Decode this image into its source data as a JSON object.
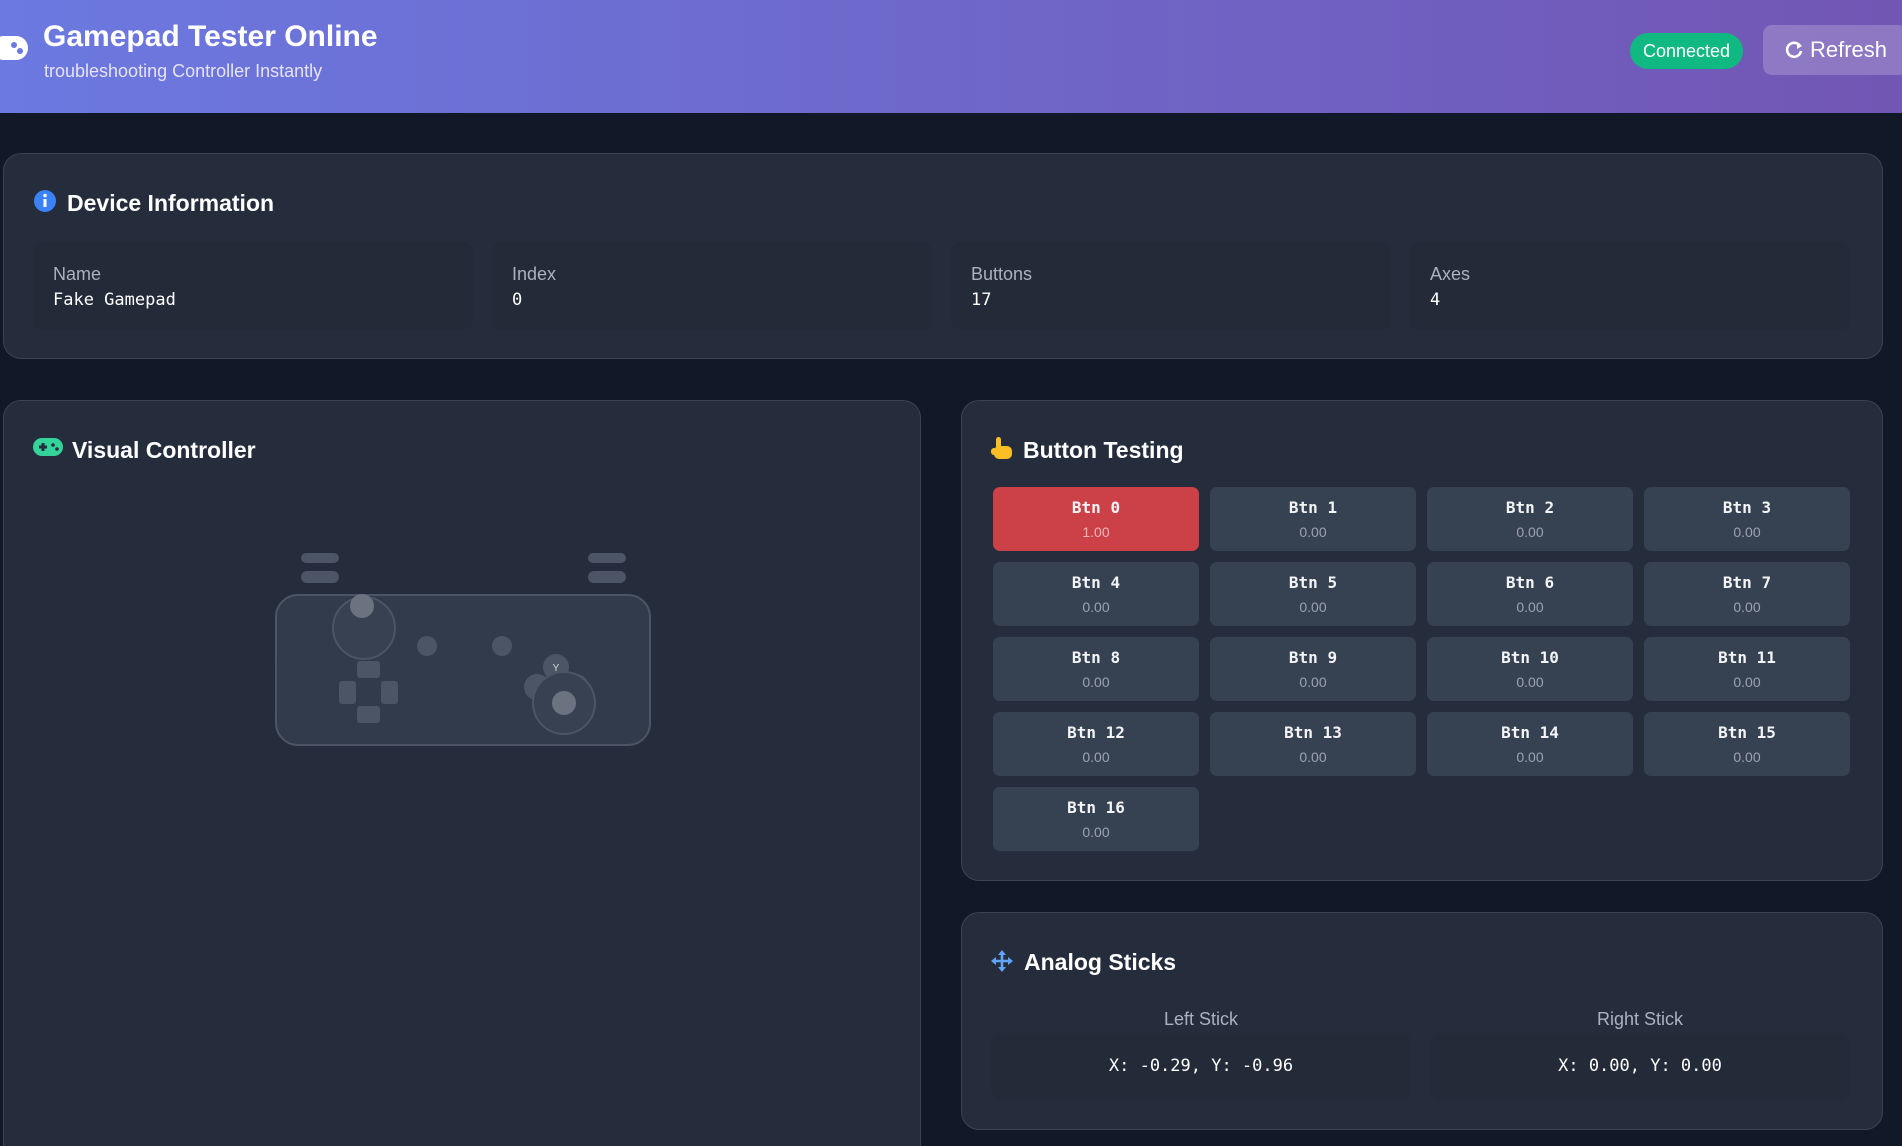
{
  "header": {
    "title": "Gamepad Tester Online",
    "subtitle": "troubleshooting Controller Instantly",
    "status": "Connected",
    "refresh_label": "Refresh"
  },
  "device_info": {
    "title": "Device Information",
    "name_label": "Name",
    "name_value": "Fake Gamepad",
    "index_label": "Index",
    "index_value": "0",
    "buttons_label": "Buttons",
    "buttons_value": "17",
    "axes_label": "Axes",
    "axes_value": "4"
  },
  "visual_controller": {
    "title": "Visual Controller",
    "face_button_label": "Y"
  },
  "button_testing": {
    "title": "Button Testing",
    "buttons": [
      {
        "name": "Btn 0",
        "value": "1.00",
        "active": true
      },
      {
        "name": "Btn 1",
        "value": "0.00",
        "active": false
      },
      {
        "name": "Btn 2",
        "value": "0.00",
        "active": false
      },
      {
        "name": "Btn 3",
        "value": "0.00",
        "active": false
      },
      {
        "name": "Btn 4",
        "value": "0.00",
        "active": false
      },
      {
        "name": "Btn 5",
        "value": "0.00",
        "active": false
      },
      {
        "name": "Btn 6",
        "value": "0.00",
        "active": false
      },
      {
        "name": "Btn 7",
        "value": "0.00",
        "active": false
      },
      {
        "name": "Btn 8",
        "value": "0.00",
        "active": false
      },
      {
        "name": "Btn 9",
        "value": "0.00",
        "active": false
      },
      {
        "name": "Btn 10",
        "value": "0.00",
        "active": false
      },
      {
        "name": "Btn 11",
        "value": "0.00",
        "active": false
      },
      {
        "name": "Btn 12",
        "value": "0.00",
        "active": false
      },
      {
        "name": "Btn 13",
        "value": "0.00",
        "active": false
      },
      {
        "name": "Btn 14",
        "value": "0.00",
        "active": false
      },
      {
        "name": "Btn 15",
        "value": "0.00",
        "active": false
      },
      {
        "name": "Btn 16",
        "value": "0.00",
        "active": false
      }
    ]
  },
  "analog_sticks": {
    "title": "Analog Sticks",
    "left_label": "Left Stick",
    "left_value": "X: -0.29, Y: -0.96",
    "right_label": "Right Stick",
    "right_value": "X: 0.00, Y: 0.00"
  },
  "colors": {
    "accent_red": "#cc4147",
    "status_green": "#10b981",
    "header_start": "#6b79e0",
    "header_end": "#7256b4"
  },
  "icons": {
    "logo": "gamepad-icon",
    "refresh": "refresh-icon",
    "device_info": "info-circle-icon",
    "visual_controller": "gamepad-icon",
    "button_testing": "pointing-hand-icon",
    "analog_sticks": "arrows-move-icon"
  }
}
